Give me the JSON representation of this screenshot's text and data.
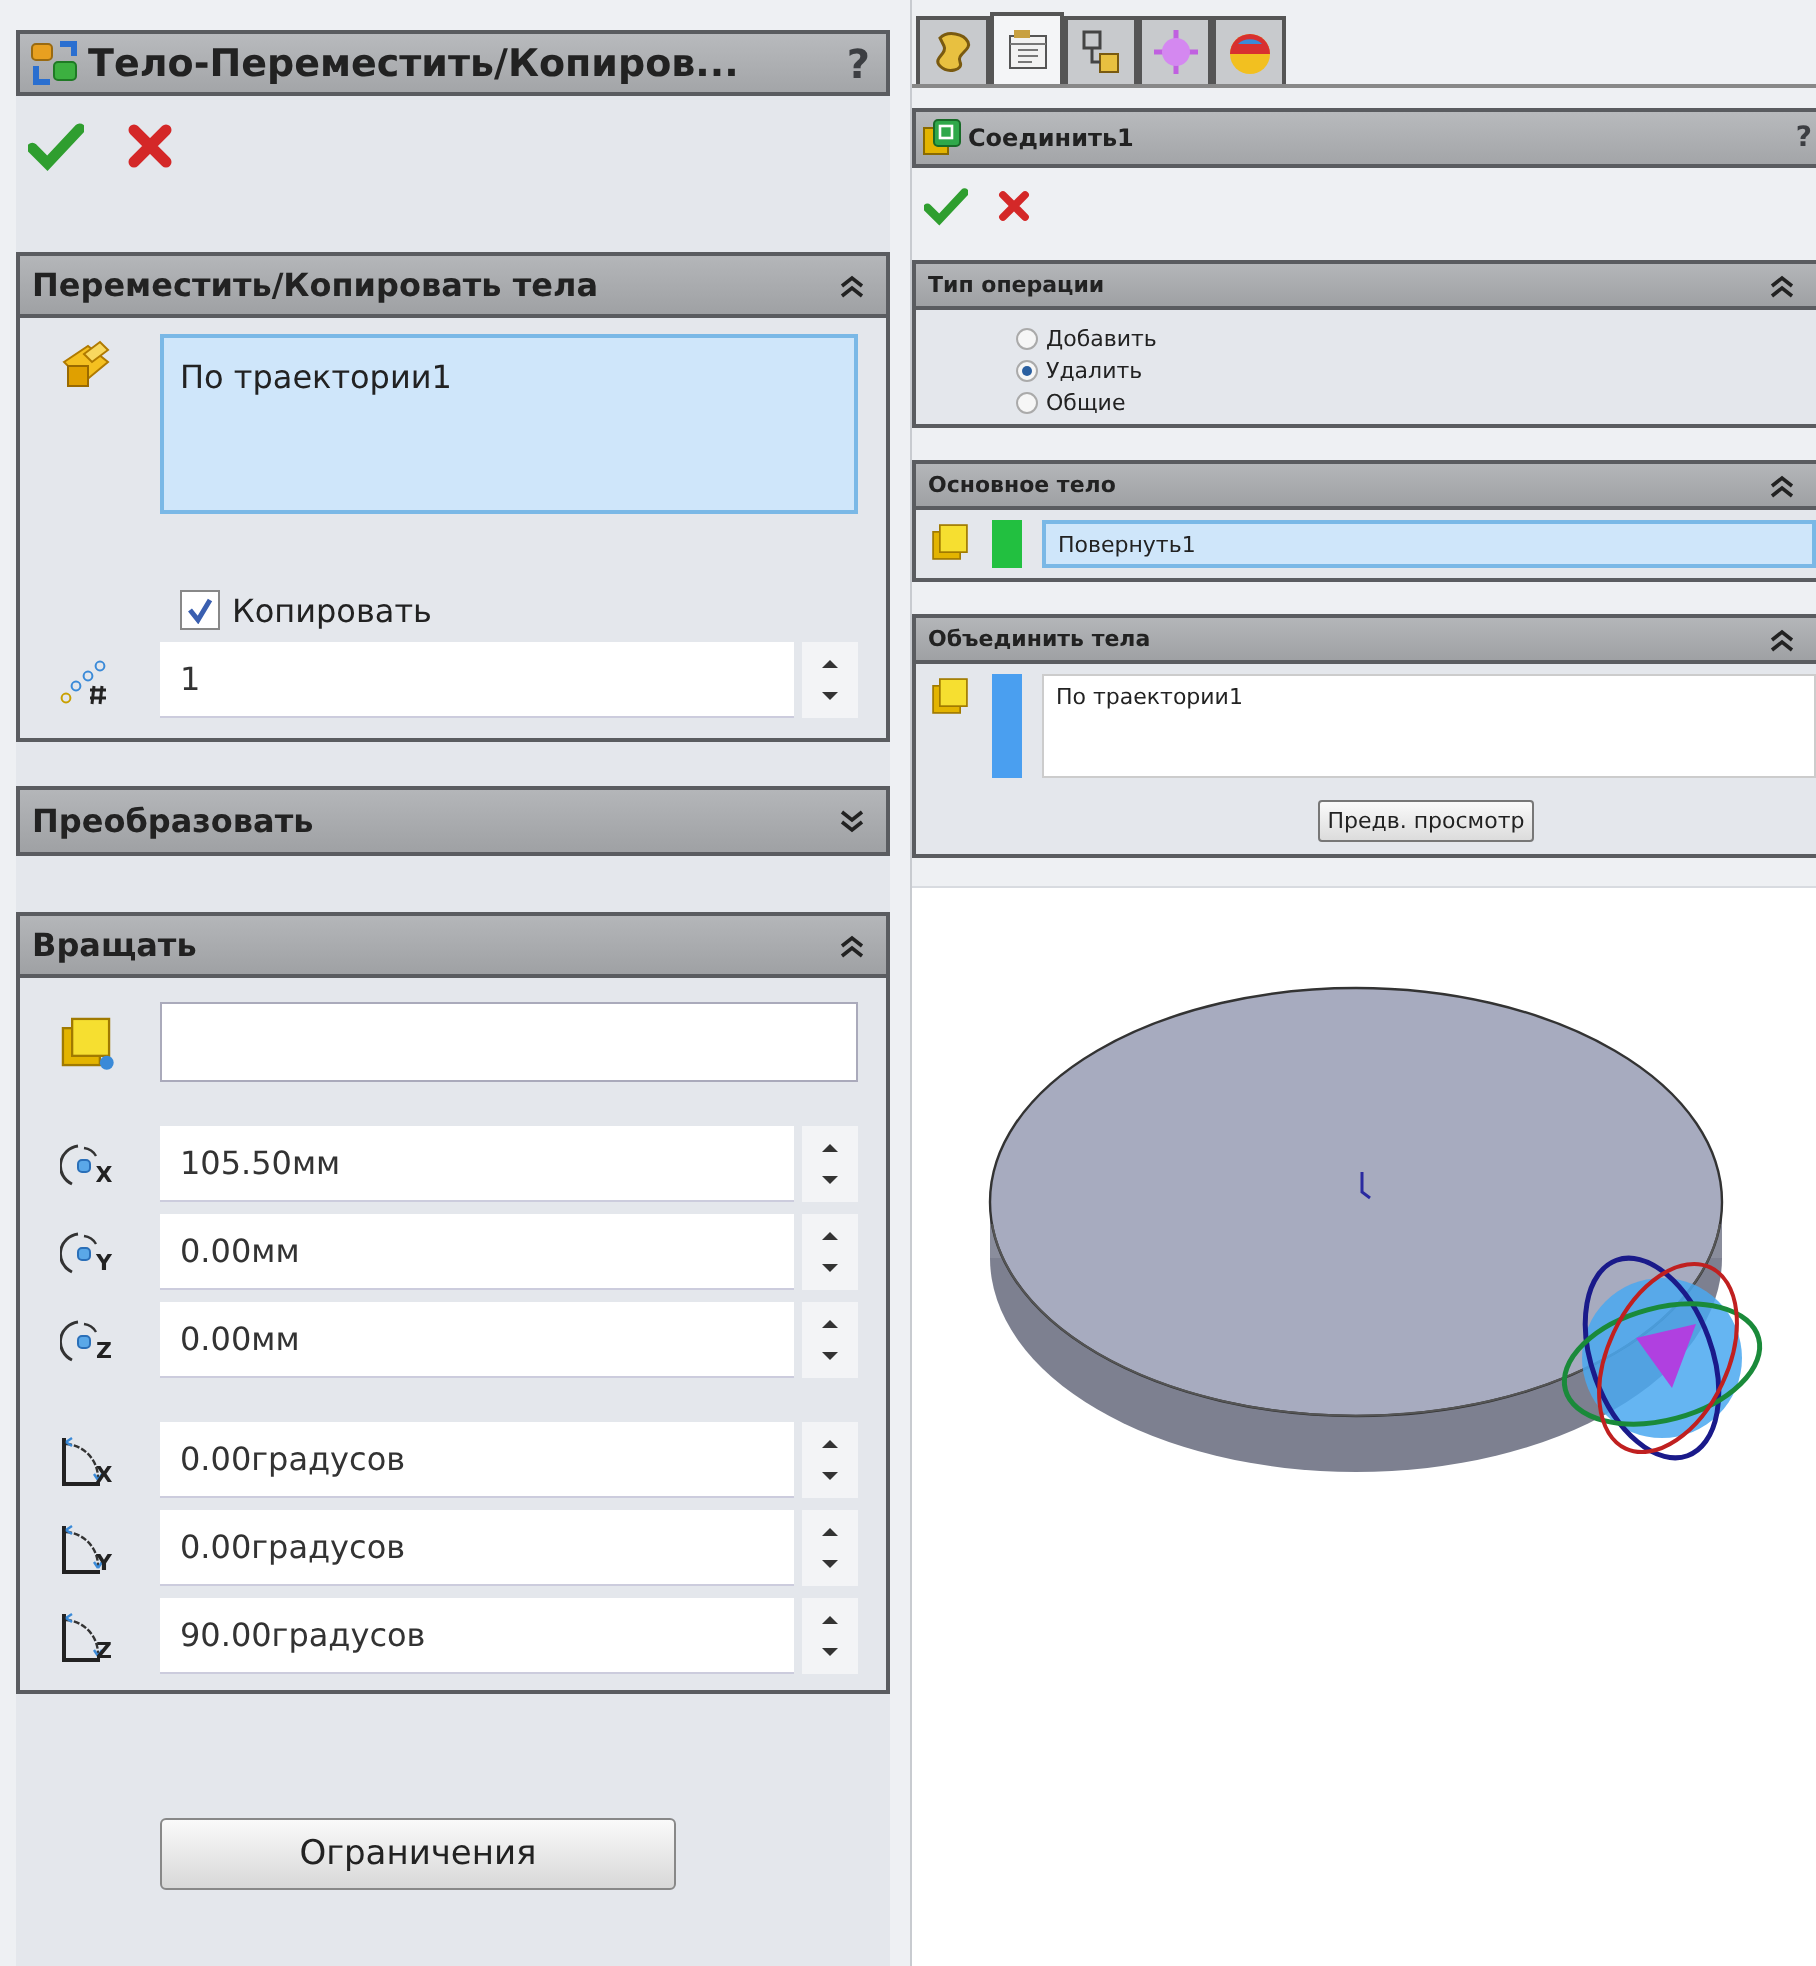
{
  "left_panel": {
    "title": "Тело-Переместить/Копиров...",
    "help": "?",
    "sections": [
      {
        "kind": "bodies",
        "title": "Переместить/Копировать тела",
        "expanded": true,
        "items": [
          "По траектории1"
        ],
        "copy": {
          "label": "Копировать",
          "checked": true
        },
        "count": "1"
      },
      {
        "kind": "transform",
        "title": "Преобразовать",
        "expanded": false
      },
      {
        "kind": "rotate",
        "title": "Вращать",
        "expanded": true,
        "coords": [
          {
            "axis": "X",
            "value": "105.50мм"
          },
          {
            "axis": "Y",
            "value": "0.00мм"
          },
          {
            "axis": "Z",
            "value": "0.00мм"
          }
        ],
        "angles": [
          {
            "axis": "X",
            "value": "0.00градусов"
          },
          {
            "axis": "Y",
            "value": "0.00градусов"
          },
          {
            "axis": "Z",
            "value": "90.00градусов"
          }
        ]
      }
    ],
    "button": "Ограничения"
  },
  "right_panel": {
    "tabs": [
      {
        "selected": false
      },
      {
        "selected": true
      },
      {
        "selected": false
      },
      {
        "selected": false
      },
      {
        "selected": false
      }
    ],
    "title": "Соединить1",
    "help": "?",
    "sections": [
      {
        "kind": "operation",
        "title": "Тип операции",
        "expanded": true,
        "options": [
          {
            "label": "Добавить",
            "selected": false
          },
          {
            "label": "Удалить",
            "selected": true
          },
          {
            "label": "Общие",
            "selected": false
          }
        ]
      },
      {
        "kind": "main_body",
        "title": "Основное тело",
        "expanded": true,
        "items": [
          "Повернуть1"
        ],
        "color": "#22c040"
      },
      {
        "kind": "combine",
        "title": "Объединить тела",
        "expanded": true,
        "items": [
          "По траектории1"
        ],
        "color": "#4a9ff0",
        "button": "Предв. просмотр"
      }
    ]
  }
}
